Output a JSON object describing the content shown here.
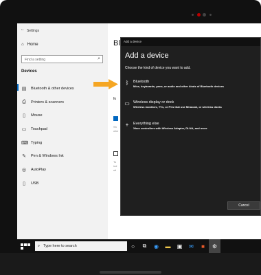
{
  "settings": {
    "window_title": "Settings",
    "home_label": "Home",
    "search_placeholder": "Find a setting",
    "section_label": "Devices",
    "nav": [
      {
        "label": "Bluetooth & other devices",
        "icon": "bluetooth-devices-icon"
      },
      {
        "label": "Printers & scanners",
        "icon": "printer-icon"
      },
      {
        "label": "Mouse",
        "icon": "mouse-icon"
      },
      {
        "label": "Touchpad",
        "icon": "touchpad-icon"
      },
      {
        "label": "Typing",
        "icon": "keyboard-icon"
      },
      {
        "label": "Pen & Windows Ink",
        "icon": "pen-icon"
      },
      {
        "label": "AutoPlay",
        "icon": "autoplay-icon"
      },
      {
        "label": "USB",
        "icon": "usb-icon"
      }
    ],
    "main_heading_peek": "Bl",
    "main_fo_peek": "fo",
    "check_text_1": "Sh\nwhe",
    "check_text_2": "To\nind\nsit"
  },
  "dialog": {
    "bar_title": "Add a device",
    "heading": "Add a device",
    "subtitle": "Choose the kind of device you want to add.",
    "options": [
      {
        "title": "Bluetooth",
        "desc": "Mice, keyboards, pens, or audio and other kinds of Bluetooth devices",
        "icon": "bluetooth-icon"
      },
      {
        "title": "Wireless display or dock",
        "desc": "Wireless monitors, TVs, or PCs that use Miracast, or wireless docks",
        "icon": "monitor-icon"
      },
      {
        "title": "Everything else",
        "desc": "Xbox controllers with Wireless Adapter, DLNA, and more",
        "icon": "plus-icon"
      }
    ],
    "cancel_label": "Cancel"
  },
  "taskbar": {
    "search_placeholder": "Type here to search"
  },
  "colors": {
    "accent": "#0067c0",
    "arrow": "#f5a623",
    "dialog_bg": "#1f1f1f"
  }
}
